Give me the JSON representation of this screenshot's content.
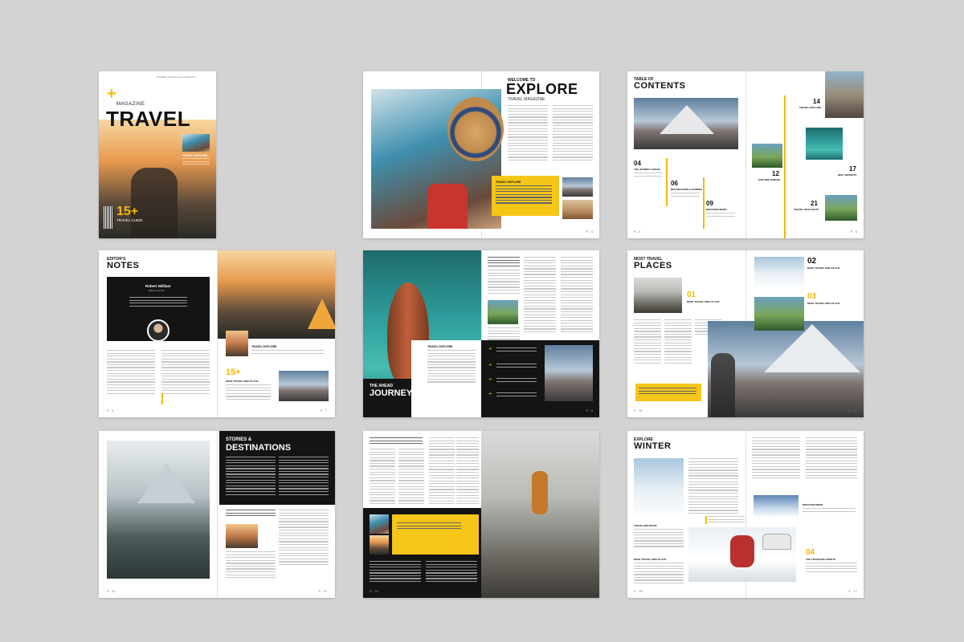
{
  "cover": {
    "top_label": "MODERN TRAVEL MAGAZINE 2017",
    "magazine": "MAGAZINE",
    "title": "TRAVEL",
    "feature_label": "TRAVEL EXPLORE",
    "count": "15+",
    "guide": "TRAVEL GUIDE"
  },
  "welcome": {
    "welcome_to": "WELCOME TO",
    "title": "EXPLORE",
    "subtitle": "TRAVEL MAGAZINE",
    "box_label": "TRAVEL EXPLORE",
    "page_left": "P - 2",
    "page_right": "P - 3"
  },
  "toc": {
    "title_top": "TABLE OF",
    "title_bottom": "CONTENTS",
    "entries": [
      {
        "num": "04",
        "label": "THE JOURNEY AHEAD"
      },
      {
        "num": "06",
        "label": "DESTINATIONS & STORIES"
      },
      {
        "num": "09",
        "label": "DISCOVER MORE"
      },
      {
        "num": "12",
        "label": "EXPLORE WINTER"
      },
      {
        "num": "14",
        "label": "TRAVEL EXPLORE"
      },
      {
        "num": "17",
        "label": "BEST RESORTS"
      },
      {
        "num": "21",
        "label": "TRAVEL HIGHLIGHTS"
      }
    ],
    "page_left": "P - 4",
    "page_right": "P - 5"
  },
  "editor": {
    "title_top": "EDITOR'S",
    "title_bottom": "NOTES",
    "name": "Robert William",
    "role": "Editor & Author",
    "label": "TRAVEL EXPLORE",
    "count": "15+",
    "count_label": "MOST TRAVEL KING PLACE",
    "page_left": "P - 6",
    "page_right": "P - 7"
  },
  "journey": {
    "title_top": "THE AHEAD",
    "title_bottom": "JOURNEY",
    "label": "TRAVEL EXPLORE",
    "page_left": "P - 8",
    "page_right": "P - 9"
  },
  "places": {
    "title_top": "MOST TRAVEL",
    "title_bottom": "PLACES",
    "n1": "01",
    "n2": "02",
    "n3": "03",
    "label": "MOST TRAVEL KING PLACE",
    "page_left": "P - 10",
    "page_right": "P - 11"
  },
  "stories": {
    "title_top": "STORIES &",
    "title_bottom": "DESTINATIONS",
    "page_left": "P - 12",
    "page_right": "P - 13"
  },
  "spread8": {
    "page_left": "P - 14",
    "page_right": "P - 15"
  },
  "winter": {
    "title_top": "EXPLORE",
    "title_bottom": "WINTER",
    "label1": "TRAVEL MOUNTAIN",
    "label2": "MOST TRAVEL KING PLACE",
    "label3": "DISCOVER MORE",
    "n4": "04",
    "label4": "TOP TRAVELING SPORTS",
    "page_left": "P - 16",
    "page_right": "P - 17"
  },
  "colors": {
    "accent": "#f5c518",
    "dark": "#141414",
    "background": "#d3d3d3"
  }
}
